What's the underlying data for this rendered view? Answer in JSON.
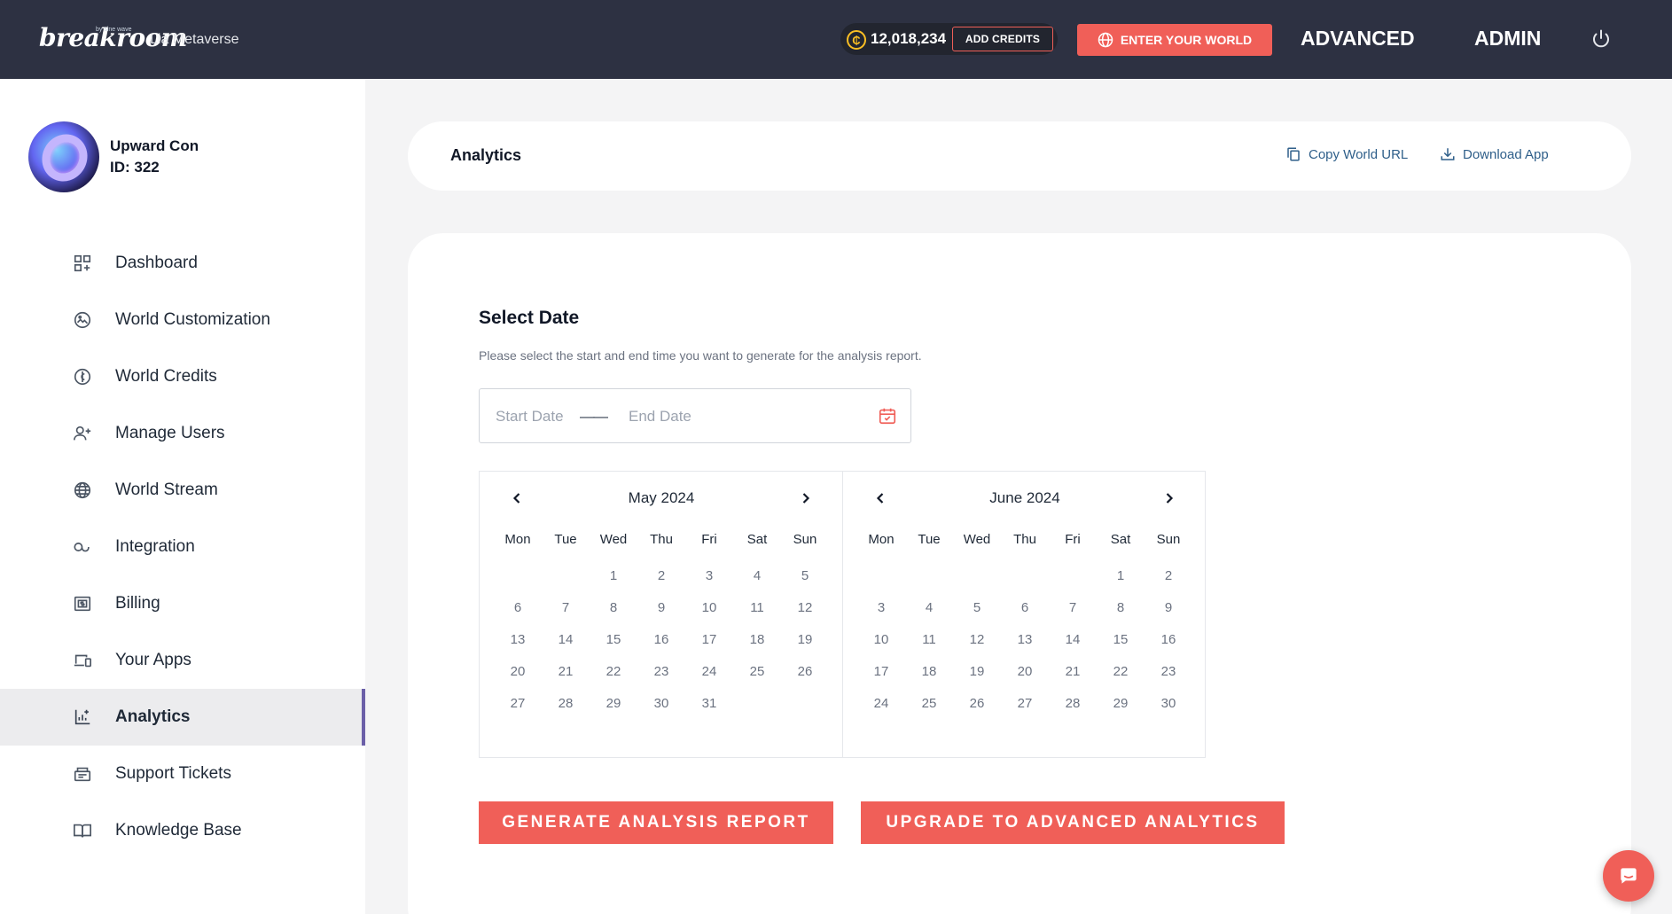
{
  "topbar": {
    "logo": "breakroom",
    "logo_sup": "by sine wave",
    "org_name": "Lia Metaverse",
    "coin_symbol": "₵",
    "credits": "12,018,234",
    "add_credits": "ADD CREDITS",
    "enter_world": "ENTER YOUR WORLD",
    "advanced": "ADVANCED",
    "admin": "ADMIN"
  },
  "sidebar": {
    "world_name": "Upward Con",
    "world_id": "ID: 322",
    "items": [
      {
        "label": "Dashboard",
        "icon": "dashboard-icon"
      },
      {
        "label": "World Customization",
        "icon": "customization-icon"
      },
      {
        "label": "World Credits",
        "icon": "credits-icon"
      },
      {
        "label": "Manage Users",
        "icon": "add-user-icon"
      },
      {
        "label": "World Stream",
        "icon": "globe-icon"
      },
      {
        "label": "Integration",
        "icon": "integration-icon"
      },
      {
        "label": "Billing",
        "icon": "billing-icon"
      },
      {
        "label": "Your Apps",
        "icon": "devices-icon"
      },
      {
        "label": "Analytics",
        "icon": "analytics-icon"
      },
      {
        "label": "Support Tickets",
        "icon": "tickets-icon"
      },
      {
        "label": "Knowledge Base",
        "icon": "book-icon"
      }
    ],
    "active_item": "Analytics"
  },
  "header": {
    "title": "Analytics",
    "copy_url": "Copy World URL",
    "download_app": "Download App"
  },
  "main": {
    "section_title": "Select Date",
    "section_desc": "Please select the start and end time you want to generate for the analysis report.",
    "start_placeholder": "Start Date",
    "separator": "——",
    "end_placeholder": "End Date",
    "weekdays": [
      "Mon",
      "Tue",
      "Wed",
      "Thu",
      "Fri",
      "Sat",
      "Sun"
    ],
    "months": [
      {
        "label": "May 2024",
        "offset": 2,
        "days": 31
      },
      {
        "label": "June 2024",
        "offset": 5,
        "days": 30
      }
    ],
    "generate_button": "GENERATE ANALYSIS REPORT",
    "upgrade_button": "UPGRADE TO ADVANCED ANALYTICS"
  },
  "colors": {
    "topbar": "#2d3142",
    "accent": "#f05f58",
    "active_bar": "#6b5fa8",
    "link": "#2f5f8a"
  }
}
